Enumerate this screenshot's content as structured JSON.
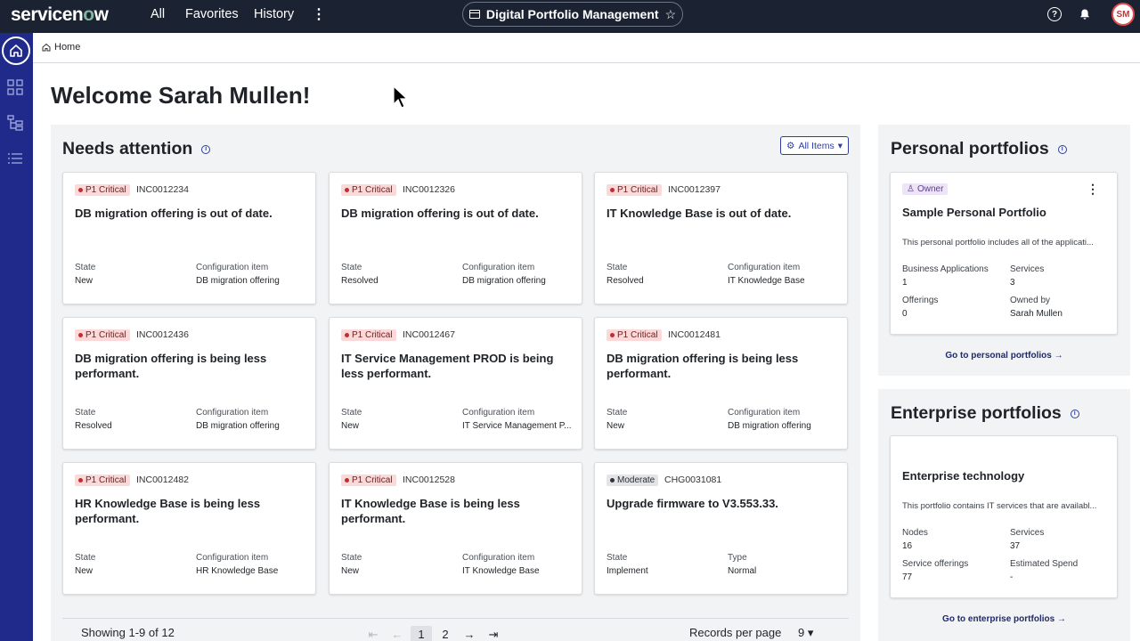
{
  "topbar": {
    "logo": "servicenow",
    "nav": [
      "All",
      "Favorites",
      "History"
    ],
    "app_title": "Digital Portfolio Management",
    "avatar_initials": "SM"
  },
  "breadcrumb": {
    "home": "Home"
  },
  "welcome": "Welcome Sarah Mullen!",
  "needs_attention": {
    "title": "Needs attention",
    "filter_label": "All Items",
    "cards": [
      {
        "priority": "P1 Critical",
        "number": "INC0012234",
        "title": "DB migration offering is out of date.",
        "label1": "State",
        "value1": "New",
        "label2": "Configuration item",
        "value2": "DB migration offering"
      },
      {
        "priority": "P1 Critical",
        "number": "INC0012326",
        "title": "DB migration offering is out of date.",
        "label1": "State",
        "value1": "Resolved",
        "label2": "Configuration item",
        "value2": "DB migration offering"
      },
      {
        "priority": "P1 Critical",
        "number": "INC0012397",
        "title": "IT Knowledge Base is out of date.",
        "label1": "State",
        "value1": "Resolved",
        "label2": "Configuration item",
        "value2": "IT Knowledge Base"
      },
      {
        "priority": "P1 Critical",
        "number": "INC0012436",
        "title": "DB migration offering is being less performant.",
        "label1": "State",
        "value1": "Resolved",
        "label2": "Configuration item",
        "value2": "DB migration offering"
      },
      {
        "priority": "P1 Critical",
        "number": "INC0012467",
        "title": "IT Service Management PROD is being less performant.",
        "label1": "State",
        "value1": "New",
        "label2": "Configuration item",
        "value2": "IT Service Management P..."
      },
      {
        "priority": "P1 Critical",
        "number": "INC0012481",
        "title": "DB migration offering is being less performant.",
        "label1": "State",
        "value1": "New",
        "label2": "Configuration item",
        "value2": "DB migration offering"
      },
      {
        "priority": "P1 Critical",
        "number": "INC0012482",
        "title": "HR Knowledge Base is being less performant.",
        "label1": "State",
        "value1": "New",
        "label2": "Configuration item",
        "value2": "HR Knowledge Base"
      },
      {
        "priority": "P1 Critical",
        "number": "INC0012528",
        "title": "IT Knowledge Base is being less performant.",
        "label1": "State",
        "value1": "New",
        "label2": "Configuration item",
        "value2": "IT Knowledge Base"
      },
      {
        "priority": "Moderate",
        "number": "CHG0031081",
        "title": "Upgrade firmware to V3.553.33.",
        "label1": "State",
        "value1": "Implement",
        "label2": "Type",
        "value2": "Normal"
      }
    ],
    "pagination": {
      "showing": "Showing 1-9 of 12",
      "pages": [
        "1",
        "2"
      ],
      "records_label": "Records per page",
      "records_value": "9"
    }
  },
  "personal": {
    "title": "Personal portfolios",
    "badge": "Owner",
    "name": "Sample Personal Portfolio",
    "desc": "This personal portfolio includes all of the applicati...",
    "f1_label": "Business Applications",
    "f1_value": "1",
    "f2_label": "Services",
    "f2_value": "3",
    "f3_label": "Offerings",
    "f3_value": "0",
    "f4_label": "Owned by",
    "f4_value": "Sarah Mullen",
    "link": "Go to personal portfolios"
  },
  "enterprise": {
    "title": "Enterprise portfolios",
    "name": "Enterprise technology",
    "desc": "This portfolio contains IT services that are availabl...",
    "f1_label": "Nodes",
    "f1_value": "16",
    "f2_label": "Services",
    "f2_value": "37",
    "f3_label": "Service offerings",
    "f3_value": "77",
    "f4_label": "Estimated Spend",
    "f4_value": "-",
    "link": "Go to enterprise portfolios"
  }
}
